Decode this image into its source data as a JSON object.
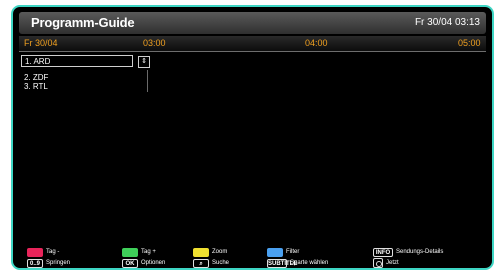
{
  "header": {
    "title": "Programm-Guide",
    "datetime": "Fr 30/04 03:13"
  },
  "timeline": {
    "date": "Fr 30/04",
    "times": [
      "03:00",
      "04:00",
      "05:00"
    ]
  },
  "channels": {
    "selected": "1. ARD",
    "scroll_icon": "updown-arrows-icon",
    "others": [
      "2. ZDF",
      "3. RTL"
    ]
  },
  "legend": {
    "red": "Tag -",
    "green": "Tag +",
    "yellow": "Zoom",
    "blue": "Filter",
    "info_key": "INFO",
    "info": "Sendungs-Details",
    "jump_key": "0..9",
    "jump": "Springen",
    "ok_key": "OK",
    "ok": "Optionen",
    "search": "Suche",
    "genre_key": "SUBTITLE",
    "genre": "Sparte wählen",
    "now": "Jetzt"
  },
  "colors": {
    "border": "#3ed6c4",
    "time": "#f0a020",
    "red": "#e8245a",
    "green": "#3fd05a",
    "yellow": "#f0e030",
    "blue": "#4aa0f0"
  }
}
